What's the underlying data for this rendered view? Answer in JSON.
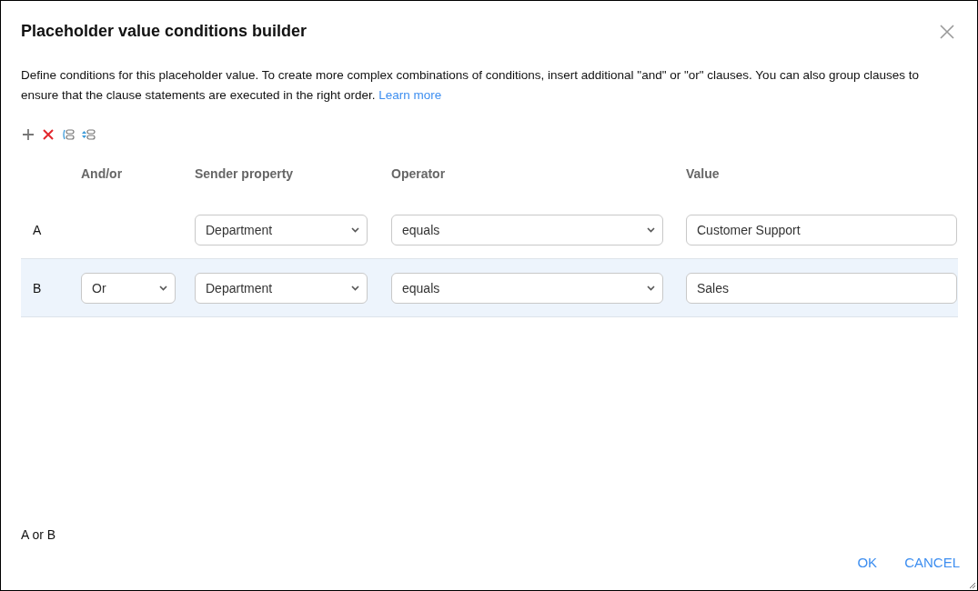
{
  "dialog": {
    "title": "Placeholder value conditions builder",
    "description": "Define conditions for this placeholder value. To create more complex combinations of conditions, insert additional \"and\" or \"or\" clauses. You can also group clauses to ensure that the clause statements are executed in the right order.",
    "link": "Learn more"
  },
  "toolbar": [
    {
      "kind": "add"
    },
    {
      "kind": "remove"
    },
    {
      "kind": "group"
    },
    {
      "kind": "ungroup"
    }
  ],
  "table": {
    "columns": [
      "And/or",
      "Sender property",
      "Operator",
      "Value"
    ],
    "rows": [
      {
        "label": "A",
        "selected": false,
        "property": "Department",
        "operator": "equals",
        "value": "Customer Support"
      },
      {
        "label": "B",
        "selected": true,
        "and_or": "Or",
        "property": "Department",
        "operator": "equals",
        "value": "Sales"
      }
    ]
  },
  "expression": "A or B",
  "buttons": [
    "OK",
    "CANCEL"
  ]
}
